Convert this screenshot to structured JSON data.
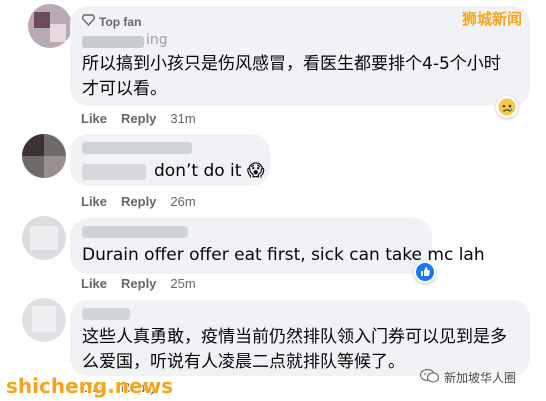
{
  "watermark": {
    "top": "狮城新闻",
    "bottom": "shicheng.news",
    "wechat": "新加坡华人圈"
  },
  "comments": [
    {
      "badge": "Top fan",
      "name_fragment": "ing",
      "text_lines": [
        "所以搞到小孩只是伤风感冒，看医生都要排个4-5个小时",
        "才可以看。"
      ],
      "like": "Like",
      "reply": "Reply",
      "time": "31m",
      "reaction": "sad-emoji-icon"
    },
    {
      "text_lines": [
        "don’t do it 😱"
      ],
      "like": "Like",
      "reply": "Reply",
      "time": "26m"
    },
    {
      "text_lines": [
        "Durain offer offer eat first, sick can take mc lah"
      ],
      "like": "Like",
      "reply": "Reply",
      "time": "25m",
      "reaction": "like-thumb-icon"
    },
    {
      "text_lines": [
        "这些人真勇敢，疫情当前仍然排队领入门券可以见到是多",
        "么爱国，听说有人凌晨二点就排队等候了。"
      ],
      "like": "Like",
      "reply": "Reply",
      "time": ""
    }
  ],
  "colors": {
    "bubble": "#f0f2f5",
    "meta": "#65676b",
    "like_blue": "#1877f2",
    "watermark_orange": "#f7a41d"
  }
}
